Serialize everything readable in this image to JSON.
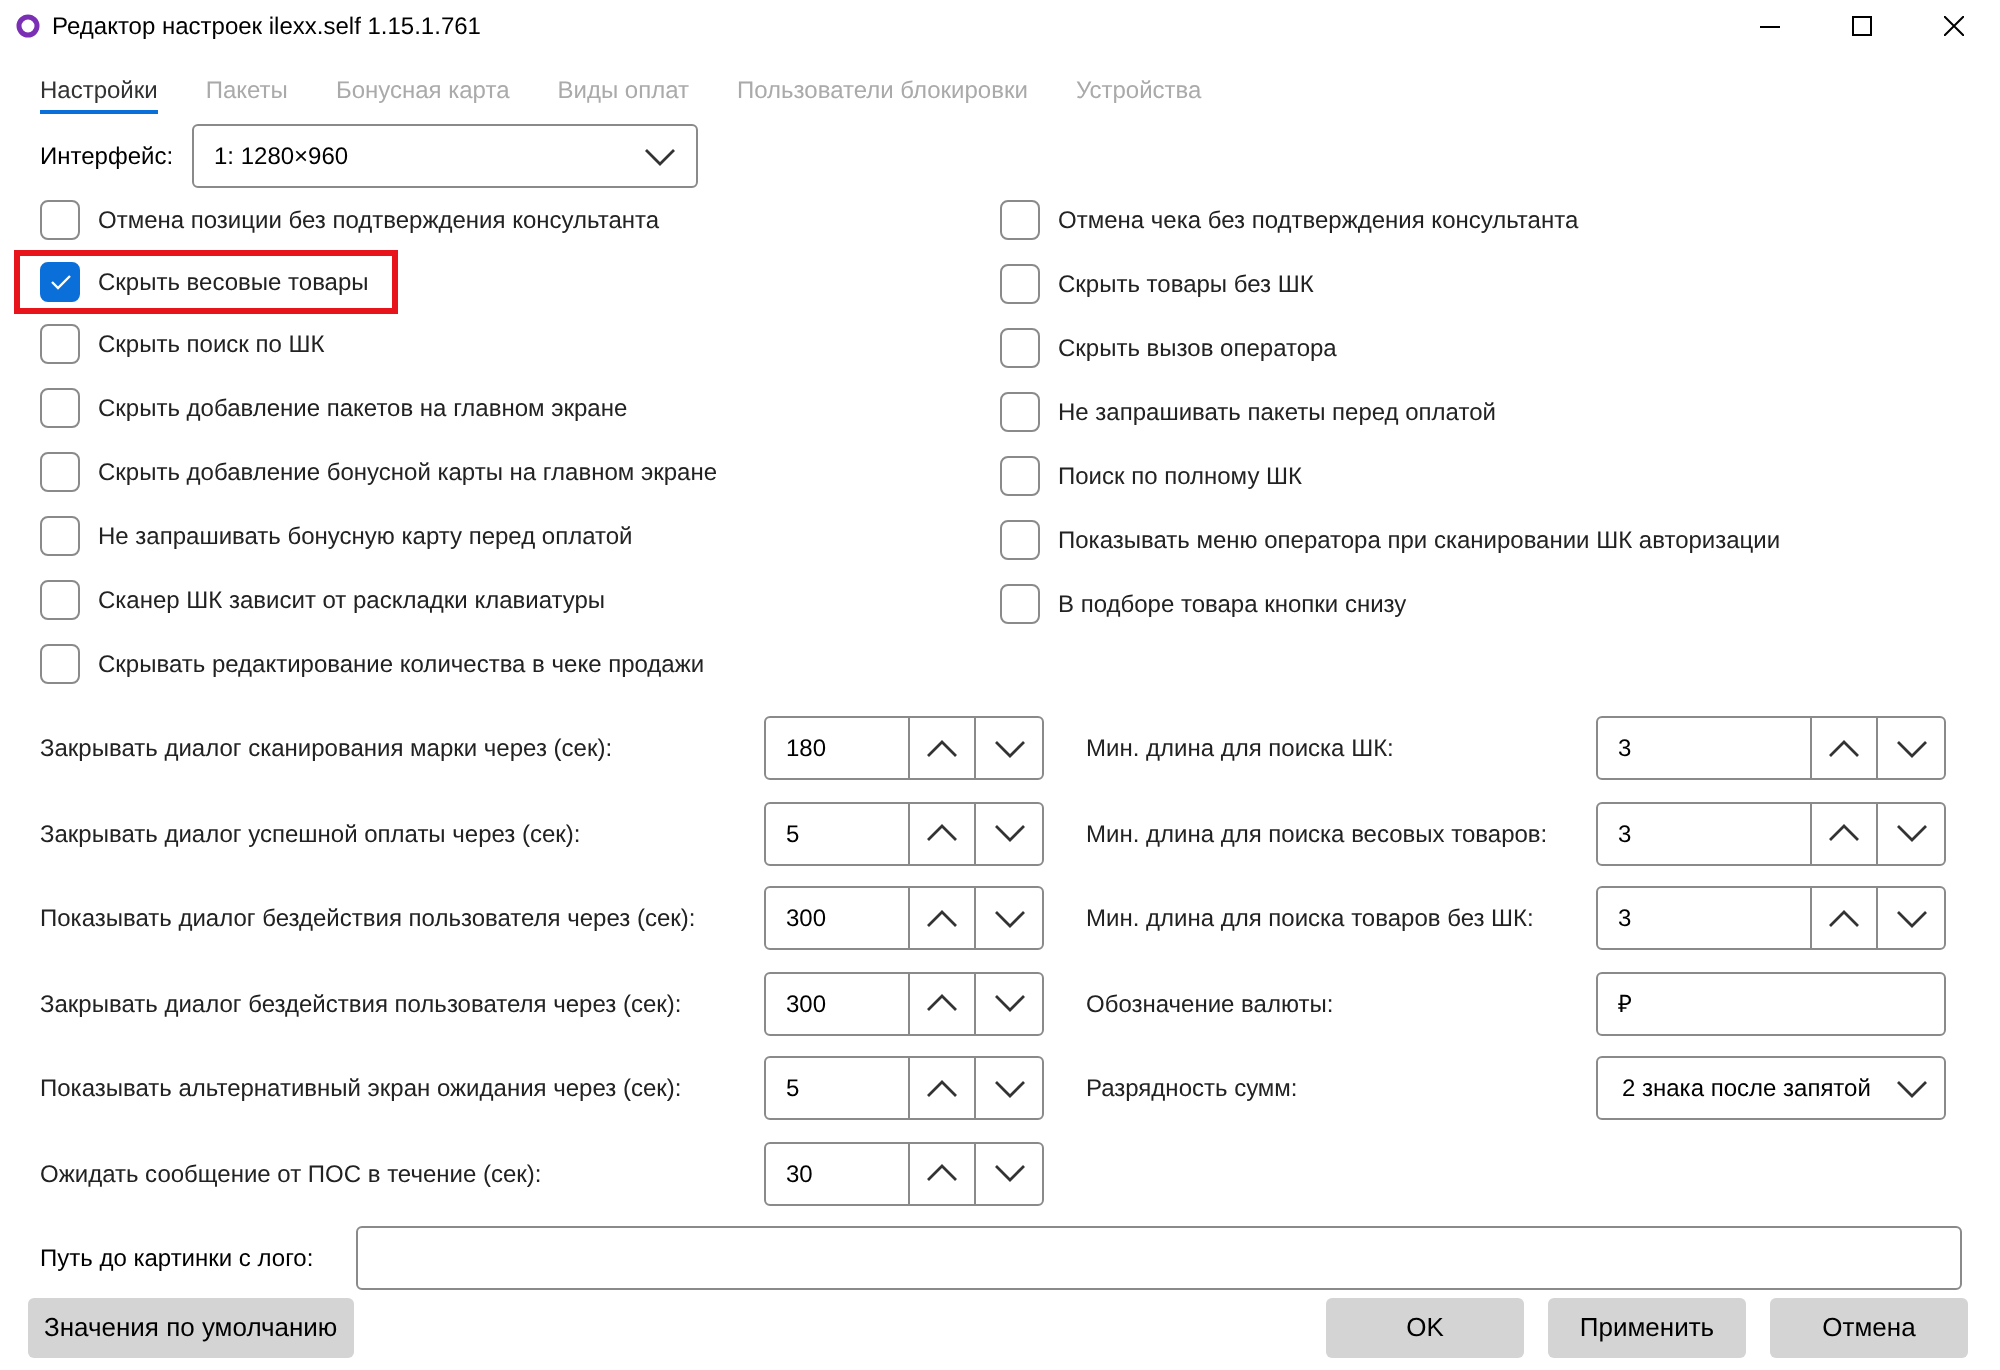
{
  "window": {
    "title": "Редактор настроек ilexx.self 1.15.1.761"
  },
  "tabs": [
    {
      "label": "Настройки",
      "selected": true
    },
    {
      "label": "Пакеты",
      "selected": false
    },
    {
      "label": "Бонусная карта",
      "selected": false
    },
    {
      "label": "Виды оплат",
      "selected": false
    },
    {
      "label": "Пользователи блокировки",
      "selected": false
    },
    {
      "label": "Устройства",
      "selected": false
    }
  ],
  "interface": {
    "label": "Интерфейс:",
    "value": "1: 1280×960"
  },
  "checkboxes_left": [
    {
      "label": "Отмена позиции без подтверждения консультанта",
      "checked": false,
      "highlighted": false
    },
    {
      "label": "Скрыть весовые товары",
      "checked": true,
      "highlighted": true
    },
    {
      "label": "Скрыть поиск по ШК",
      "checked": false,
      "highlighted": false
    },
    {
      "label": "Скрыть добавление пакетов на главном экране",
      "checked": false,
      "highlighted": false
    },
    {
      "label": "Скрыть добавление бонусной карты на главном экране",
      "checked": false,
      "highlighted": false
    },
    {
      "label": "Не запрашивать бонусную карту перед оплатой",
      "checked": false,
      "highlighted": false
    },
    {
      "label": "Сканер ШК зависит от раскладки клавиатуры",
      "checked": false,
      "highlighted": false
    },
    {
      "label": "Скрывать редактирование количества в чеке продажи",
      "checked": false,
      "highlighted": false
    }
  ],
  "checkboxes_right": [
    {
      "label": "Отмена чека без подтверждения консультанта",
      "checked": false,
      "highlighted": false
    },
    {
      "label": "Скрыть товары без ШК",
      "checked": false,
      "highlighted": false
    },
    {
      "label": "Скрыть вызов оператора",
      "checked": false,
      "highlighted": false
    },
    {
      "label": "Не запрашивать пакеты перед оплатой",
      "checked": false,
      "highlighted": false
    },
    {
      "label": "Поиск по полному ШК",
      "checked": false,
      "highlighted": false
    },
    {
      "label": "Показывать меню оператора при сканировании ШК авторизации",
      "checked": false,
      "highlighted": false
    },
    {
      "label": "В подборе товара кнопки снизу",
      "checked": false,
      "highlighted": false
    }
  ],
  "fields_left": [
    {
      "kind": "spin",
      "label": "Закрывать диалог сканирования марки через (сек):",
      "value": "180"
    },
    {
      "kind": "spin",
      "label": "Закрывать диалог успешной оплаты через (сек):",
      "value": "5"
    },
    {
      "kind": "spin",
      "label": "Показывать диалог бездействия пользователя через (сек):",
      "value": "300"
    },
    {
      "kind": "spin",
      "label": "Закрывать диалог бездействия пользователя через (сек):",
      "value": "300"
    },
    {
      "kind": "spin",
      "label": "Показывать альтернативный экран ожидания через (сек):",
      "value": "5"
    },
    {
      "kind": "spin",
      "label": "Ожидать сообщение от ПОС в течение (сек):",
      "value": "30"
    }
  ],
  "fields_right": [
    {
      "kind": "spin",
      "label": "Мин. длина для поиска ШК:",
      "value": "3"
    },
    {
      "kind": "spin",
      "label": "Мин. длина для поиска весовых товаров:",
      "value": "3"
    },
    {
      "kind": "spin",
      "label": "Мин. длина для поиска товаров без ШК:",
      "value": "3"
    },
    {
      "kind": "text",
      "label": "Обозначение валюты:",
      "value": "₽"
    },
    {
      "kind": "select",
      "label": "Разрядность сумм:",
      "value": "2 знака после запятой"
    }
  ],
  "logo_path": {
    "label": "Путь до картинки с лого:"
  },
  "buttons": {
    "defaults": "Значения по умолчанию",
    "ok": "OK",
    "apply": "Применить",
    "cancel": "Отмена"
  }
}
